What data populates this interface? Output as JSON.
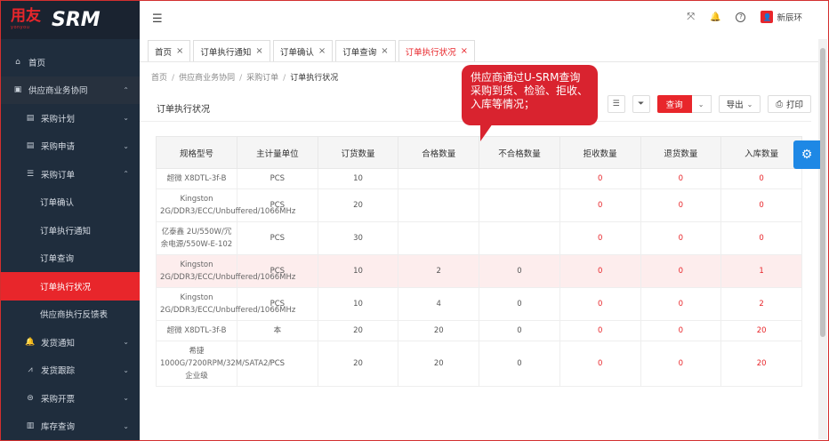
{
  "logo": {
    "brand": "用友",
    "brand_sub": "yonyou",
    "product": "SRM"
  },
  "sidebar": {
    "items": [
      {
        "label": "首页",
        "icon": "home-icon",
        "glyph": "⌂",
        "level": 0
      },
      {
        "label": "供应商业务协同",
        "icon": "briefcase-icon",
        "glyph": "▣",
        "level": 0,
        "chevron": "⌃"
      },
      {
        "label": "采购计划",
        "icon": "doc-icon",
        "glyph": "▤",
        "level": 1,
        "chevron": "⌄"
      },
      {
        "label": "采购申请",
        "icon": "doc-icon",
        "glyph": "▤",
        "level": 1,
        "chevron": "⌄"
      },
      {
        "label": "采购订单",
        "icon": "list-icon",
        "glyph": "☰",
        "level": 1,
        "chevron": "⌃"
      },
      {
        "label": "订单确认",
        "level": 2
      },
      {
        "label": "订单执行通知",
        "level": 2
      },
      {
        "label": "订单查询",
        "level": 2
      },
      {
        "label": "订单执行状况",
        "level": 2,
        "active": true
      },
      {
        "label": "供应商执行反馈表",
        "level": 2
      },
      {
        "label": "发货通知",
        "icon": "bell-icon",
        "glyph": "🔔",
        "level": 1,
        "chevron": "⌄"
      },
      {
        "label": "发货跟踪",
        "icon": "chart-icon",
        "glyph": "⩘",
        "level": 1,
        "chevron": "⌄"
      },
      {
        "label": "采购开票",
        "icon": "invoice-icon",
        "glyph": "⊜",
        "level": 1,
        "chevron": "⌄"
      },
      {
        "label": "库存查询",
        "icon": "box-icon",
        "glyph": "▥",
        "level": 1,
        "chevron": "⌄"
      }
    ]
  },
  "header": {
    "user_name": "新辰环",
    "icons": {
      "fullscreen": "⤧",
      "bell": "🔔",
      "help": "?"
    }
  },
  "tabs": [
    {
      "label": "首页"
    },
    {
      "label": "订单执行通知"
    },
    {
      "label": "订单确认"
    },
    {
      "label": "订单查询"
    },
    {
      "label": "订单执行状况",
      "active": true
    }
  ],
  "breadcrumb": [
    "首页",
    "供应商业务协同",
    "采购订单",
    "订单执行状况"
  ],
  "page": {
    "title": "订单执行状况",
    "query_label": "查询",
    "export_label": "导出",
    "print_label": "打印"
  },
  "callout": {
    "text": "供应商通过U-SRM查询采购到货、检验、拒收、入库等情况；"
  },
  "table": {
    "columns": [
      "规格型号",
      "主计量单位",
      "订货数量",
      "合格数量",
      "不合格数量",
      "拒收数量",
      "退货数量",
      "入库数量"
    ],
    "rows": [
      {
        "cells": [
          "超微 X8DTL-3f-B",
          "PCS",
          "10",
          "",
          "",
          "0",
          "0",
          "0"
        ]
      },
      {
        "cells": [
          "Kingston 2G/DDR3/ECC/Unbuffered/1066MHz",
          "PCS",
          "20",
          "",
          "",
          "0",
          "0",
          "0"
        ]
      },
      {
        "cells": [
          "亿泰鑫 2U/550W/冗余电源/550W-E-102",
          "PCS",
          "30",
          "",
          "",
          "0",
          "0",
          "0"
        ]
      },
      {
        "cells": [
          "Kingston 2G/DDR3/ECC/Unbuffered/1066MHz",
          "PCS",
          "10",
          "2",
          "0",
          "0",
          "0",
          "1"
        ],
        "highlight": true
      },
      {
        "cells": [
          "Kingston 2G/DDR3/ECC/Unbuffered/1066MHz",
          "PCS",
          "10",
          "4",
          "0",
          "0",
          "0",
          "2"
        ]
      },
      {
        "cells": [
          "超微 X8DTL-3f-B",
          "本",
          "20",
          "20",
          "0",
          "0",
          "0",
          "20"
        ]
      },
      {
        "cells": [
          "希捷 1000G/7200RPM/32M/SATA2/企业级",
          "PCS",
          "20",
          "20",
          "0",
          "0",
          "0",
          "20"
        ]
      }
    ]
  }
}
